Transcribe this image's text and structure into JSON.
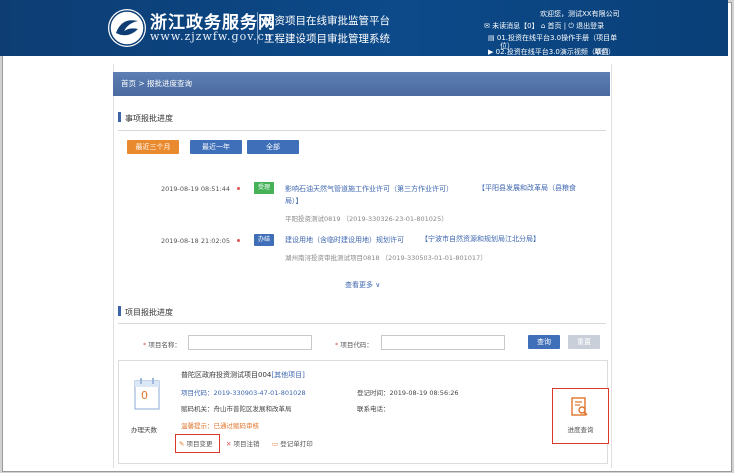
{
  "header": {
    "site_name": "浙江政务服务网",
    "site_url": "www.zjzwfw.gov.cn",
    "system_line1": "投资项目在线审批监管平台",
    "system_line2": "工程建设项目审批管理系统",
    "welcome": "欢迎您，测试XX有限公司",
    "unread": "未读消息【0】",
    "home": "首页",
    "logout": "退出登录",
    "manual1": "01.投资在线平台3.0操作手册（项目单",
    "manual1_cont": "位）",
    "manual2": "02.投资在线平台3.0演示视频（项目",
    "manual2_cont": "单位）"
  },
  "breadcrumb": "首页 > 报批进度查询",
  "section1": {
    "title": "事项报批进度",
    "filters": [
      "最近三个月",
      "最近一年",
      "全部"
    ],
    "items": [
      {
        "time": "2019-08-19 08:51:44",
        "status": "受理",
        "name": "影响石油天然气管道施工作业许可（第三方作业许可）",
        "dept": "【平阳县发展和改革局（县粮食",
        "dept_cont": "局）】",
        "project": "平阳投资测试0819  （2019-330326-23-01-801025）"
      },
      {
        "time": "2019-08-18 21:02:05",
        "status": "办结",
        "name": "建设用地（含临时建设用地）规划许可",
        "dept": "【宁波市自然资源和规划局江北分局】",
        "project": "湖州南浔投资审批测试项目0818  （2019-330503-01-01-801017）"
      }
    ],
    "view_more": "查看更多 ∨"
  },
  "section2": {
    "title": "项目报批进度",
    "name_label": "项目名称：",
    "code_label": "项目代码：",
    "name_value": "",
    "code_value": "",
    "search": "查询",
    "reset": "重置"
  },
  "project_card": {
    "days": "0",
    "days_label": "办理天数",
    "title": "普陀区政府投资测试项目004",
    "type": "[其他项目]",
    "code": "项目代码：2019-330903-47-01-801028",
    "register_time": "登记时间：2019-08-19 08:56:26",
    "org": "赋码机关：舟山市普陀区发展和改革局",
    "phone": "联系电话：",
    "tip": "温馨提示：已通过赋码审核",
    "actions": [
      "项目变更",
      "项目注销",
      "登记单打印"
    ],
    "progress": "进度查询"
  },
  "colors": {
    "header_bg": "#0c4a8a",
    "crumb_bg": "#4a6aa0",
    "accent_blue": "#3f6fb8",
    "orange": "#ea8a2f",
    "green": "#45b257",
    "highlight_red": "#d9372c"
  }
}
